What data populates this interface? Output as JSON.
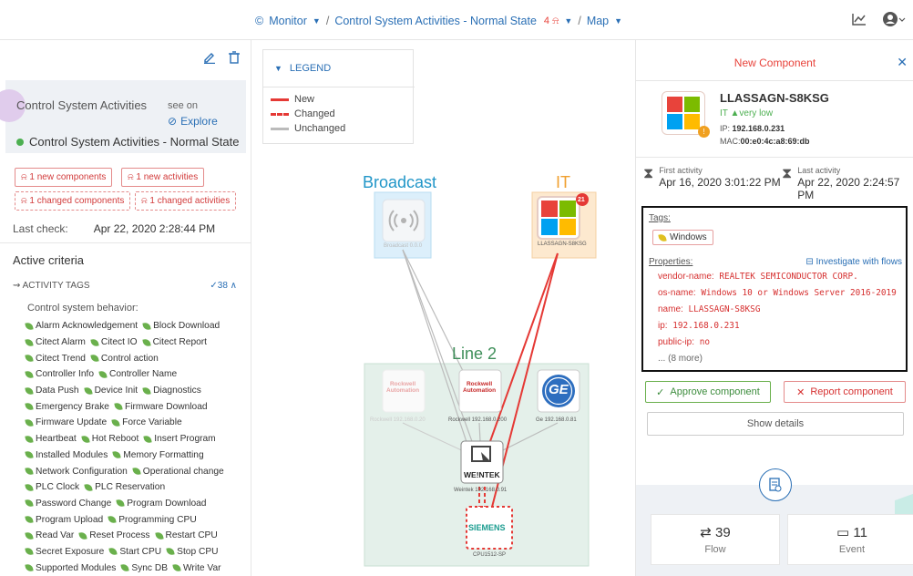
{
  "breadcrumb": {
    "monitor": "Monitor",
    "preset": "Control System Activities - Normal State",
    "alert_count": "4",
    "view": "Map"
  },
  "left": {
    "preset_title": "Control System Activities",
    "see_on": "see on",
    "explore": "Explore",
    "state": "Control System Activities - Normal State",
    "badges": {
      "new_components": "1 new components",
      "new_activities": "1 new activities",
      "changed_components": "1 changed components",
      "changed_activities": "1 changed activities"
    },
    "last_check_label": "Last check:",
    "last_check_value": "Apr 22, 2020 2:28:44 PM",
    "active_criteria": "Active criteria",
    "activity_tags_label": "ACTIVITY TAGS",
    "activity_tags_count": "38",
    "category": "Control system behavior:",
    "tag_rows": [
      [
        "Alarm Acknowledgement",
        "Block Download"
      ],
      [
        "Citect Alarm",
        "Citect IO",
        "Citect Report"
      ],
      [
        "Citect Trend",
        "Control action"
      ],
      [
        "Controller Info",
        "Controller Name"
      ],
      [
        "Data Push",
        "Device Init",
        "Diagnostics"
      ],
      [
        "Emergency Brake",
        "Firmware Download"
      ],
      [
        "Firmware Update",
        "Force Variable"
      ],
      [
        "Heartbeat",
        "Hot Reboot",
        "Insert Program"
      ],
      [
        "Installed Modules",
        "Memory Formatting"
      ],
      [
        "Network Configuration",
        "Operational change"
      ],
      [
        "PLC Clock",
        "PLC Reservation"
      ],
      [
        "Password Change",
        "Program Download"
      ],
      [
        "Program Upload",
        "Programming CPU"
      ],
      [
        "Read Var",
        "Reset Process",
        "Restart CPU"
      ],
      [
        "Secret Exposure",
        "Start CPU",
        "Stop CPU"
      ],
      [
        "Supported Modules",
        "Sync DB",
        "Write Var"
      ]
    ]
  },
  "legend": {
    "title": "LEGEND",
    "new": "New",
    "changed": "Changed",
    "unchanged": "Unchanged"
  },
  "map": {
    "groups": {
      "broadcast": "Broadcast",
      "it": "IT",
      "line2": "Line 2"
    },
    "nodes": {
      "broadcast": "Broadcast 0.0.0",
      "it": "LLASSAGN-S8KSG",
      "it_badge": "21",
      "rockwell_faded": "Rockwell 192.168.0.20",
      "rockwell": "Rockwell 192.168.0.200",
      "ge": "Ge 192.168.0.81",
      "weintek": "Weintek 192.168.0.91",
      "siemens": "CPU1512-SP",
      "rockwell_logo": "Rockwell\nAutomation",
      "weintek_logo": "WE!NTEK",
      "siemens_logo": "SIEMENS",
      "ge_logo": "GE"
    }
  },
  "panel": {
    "title": "New Component",
    "name": "LLASSAGN-S8KSG",
    "level_prefix": "IT",
    "level": "very low",
    "ip_label": "IP:",
    "ip": "192.168.0.231",
    "mac_label": "MAC:",
    "mac": "00:e0:4c:a8:69:db",
    "badge": "!",
    "first_activity_label": "First activity",
    "first_activity": "Apr 16, 2020 3:01:22 PM",
    "last_activity_label": "Last activity",
    "last_activity": "Apr 22, 2020 2:24:57 PM",
    "tags_label": "Tags:",
    "tag": "Windows",
    "properties_label": "Properties:",
    "investigate": "Investigate with flows",
    "properties": [
      {
        "k": "vendor-name:",
        "v": "REALTEK SEMICONDUCTOR CORP."
      },
      {
        "k": "os-name:",
        "v": "Windows 10 or Windows Server 2016-2019"
      },
      {
        "k": "name:",
        "v": "LLASSAGN-S8KSG"
      },
      {
        "k": "ip:",
        "v": "192.168.0.231"
      },
      {
        "k": "public-ip:",
        "v": "no"
      }
    ],
    "more": "... (8 more)",
    "approve": "Approve component",
    "report": "Report component",
    "details": "Show details",
    "flow_count": "39",
    "flow_label": "Flow",
    "event_count": "11",
    "event_label": "Event"
  },
  "colors": {
    "accent": "#2a6fb5",
    "red": "#e8433b",
    "green": "#4caf50",
    "win_red": "#e8433b",
    "win_green": "#7cbb00",
    "win_blue": "#00a1f1",
    "win_yellow": "#ffbb00"
  }
}
